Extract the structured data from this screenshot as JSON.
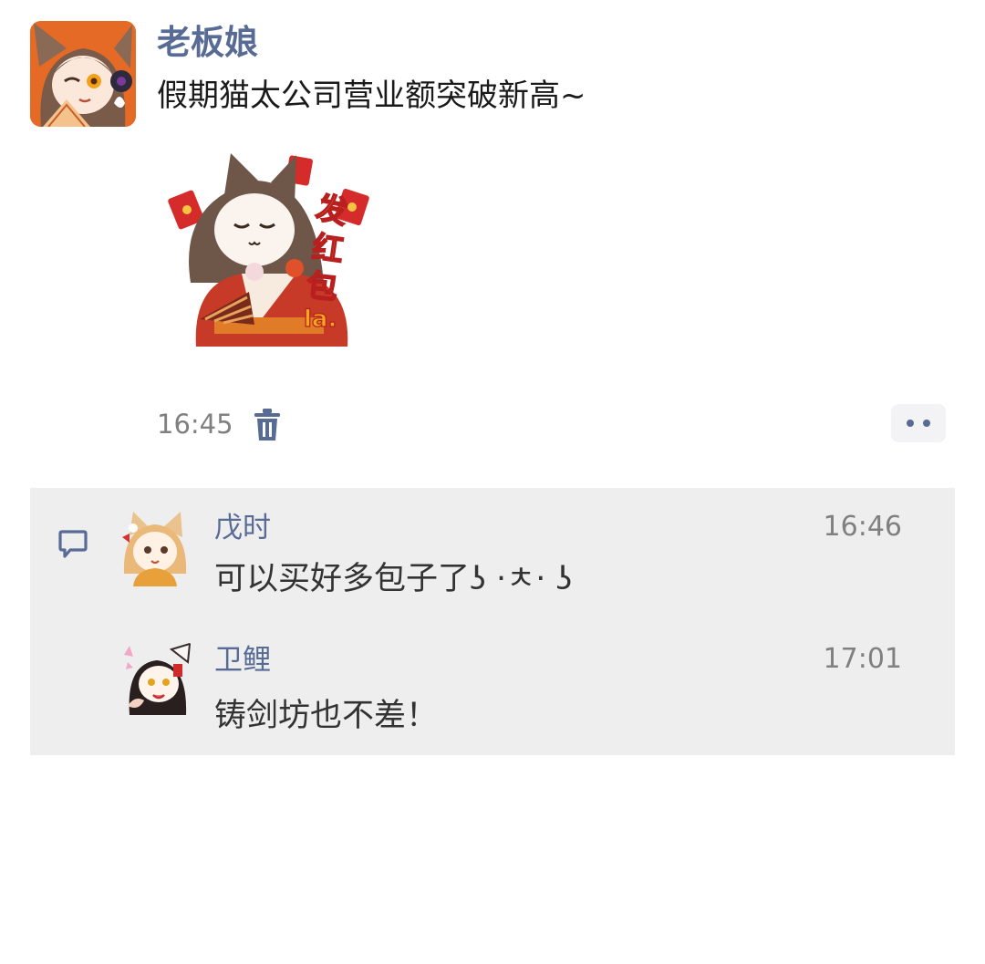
{
  "post": {
    "author": "老板娘",
    "text": "假期猫太公司营业额突破新高~",
    "time": "16:45"
  },
  "sticker": {
    "lettering": "发红包la."
  },
  "comments": [
    {
      "name": "戊时",
      "time": "16:46",
      "text": "可以买好多包子了ʖ ·ㅊ· ʖ"
    },
    {
      "name": "卫鲤",
      "time": "17:01",
      "text": "铸剑坊也不差！"
    }
  ],
  "icons": {
    "delete": "trash-icon",
    "more": "more-dots-icon",
    "comment": "comment-bubble-icon"
  },
  "colors": {
    "name_link": "#576b95",
    "comment_bg": "#eeeeee",
    "meta_gray": "#808080"
  }
}
